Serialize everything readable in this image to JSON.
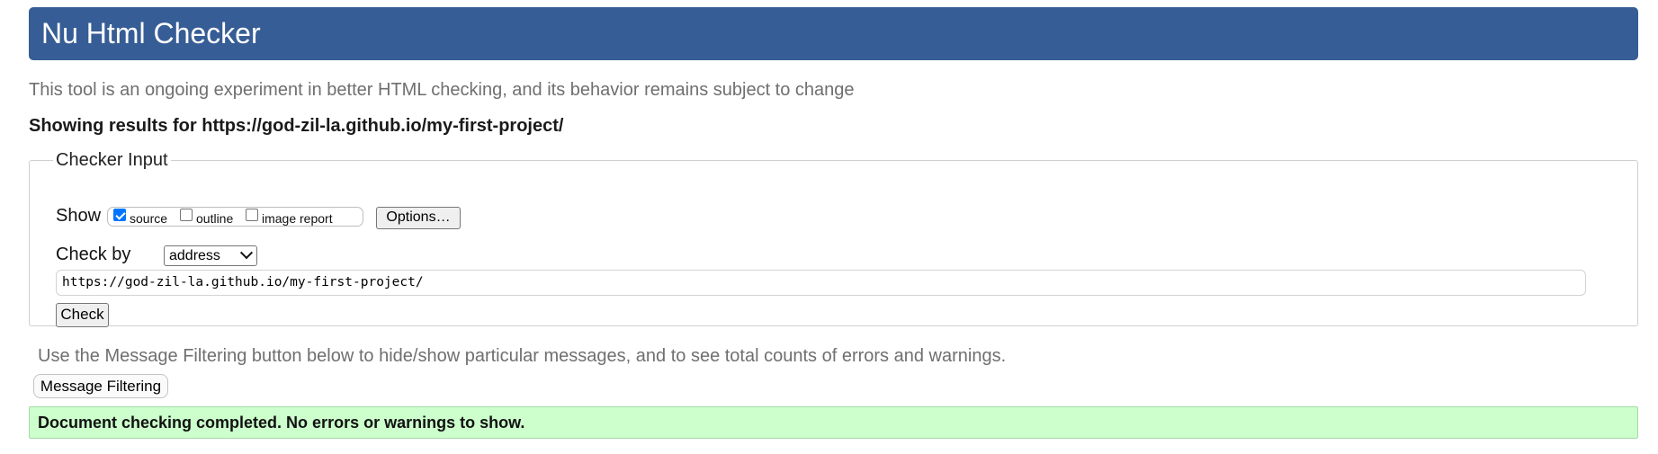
{
  "header": {
    "title": "Nu Html Checker"
  },
  "tagline": "This tool is an ongoing experiment in better HTML checking, and its behavior remains subject to change",
  "results_for": "Showing results for https://god-zil-la.github.io/my-first-project/",
  "checker_input": {
    "legend": "Checker Input",
    "show_label": "Show",
    "show_options": [
      {
        "label": "source",
        "checked": true
      },
      {
        "label": "outline",
        "checked": false
      },
      {
        "label": "image report",
        "checked": false
      }
    ],
    "options_button": "Options…",
    "check_by_label": "Check by",
    "check_by_selected": "address",
    "url_value": "https://god-zil-la.github.io/my-first-project/",
    "check_button": "Check"
  },
  "filter_note": "Use the Message Filtering button below to hide/show particular messages, and to see total counts of errors and warnings.",
  "filter_button": "Message Filtering",
  "success_message": "Document checking completed. No errors or warnings to show.",
  "colors": {
    "header_bg": "#365d95",
    "success_bg": "#ccffcc",
    "checkbox_checked": "#0075ff"
  }
}
